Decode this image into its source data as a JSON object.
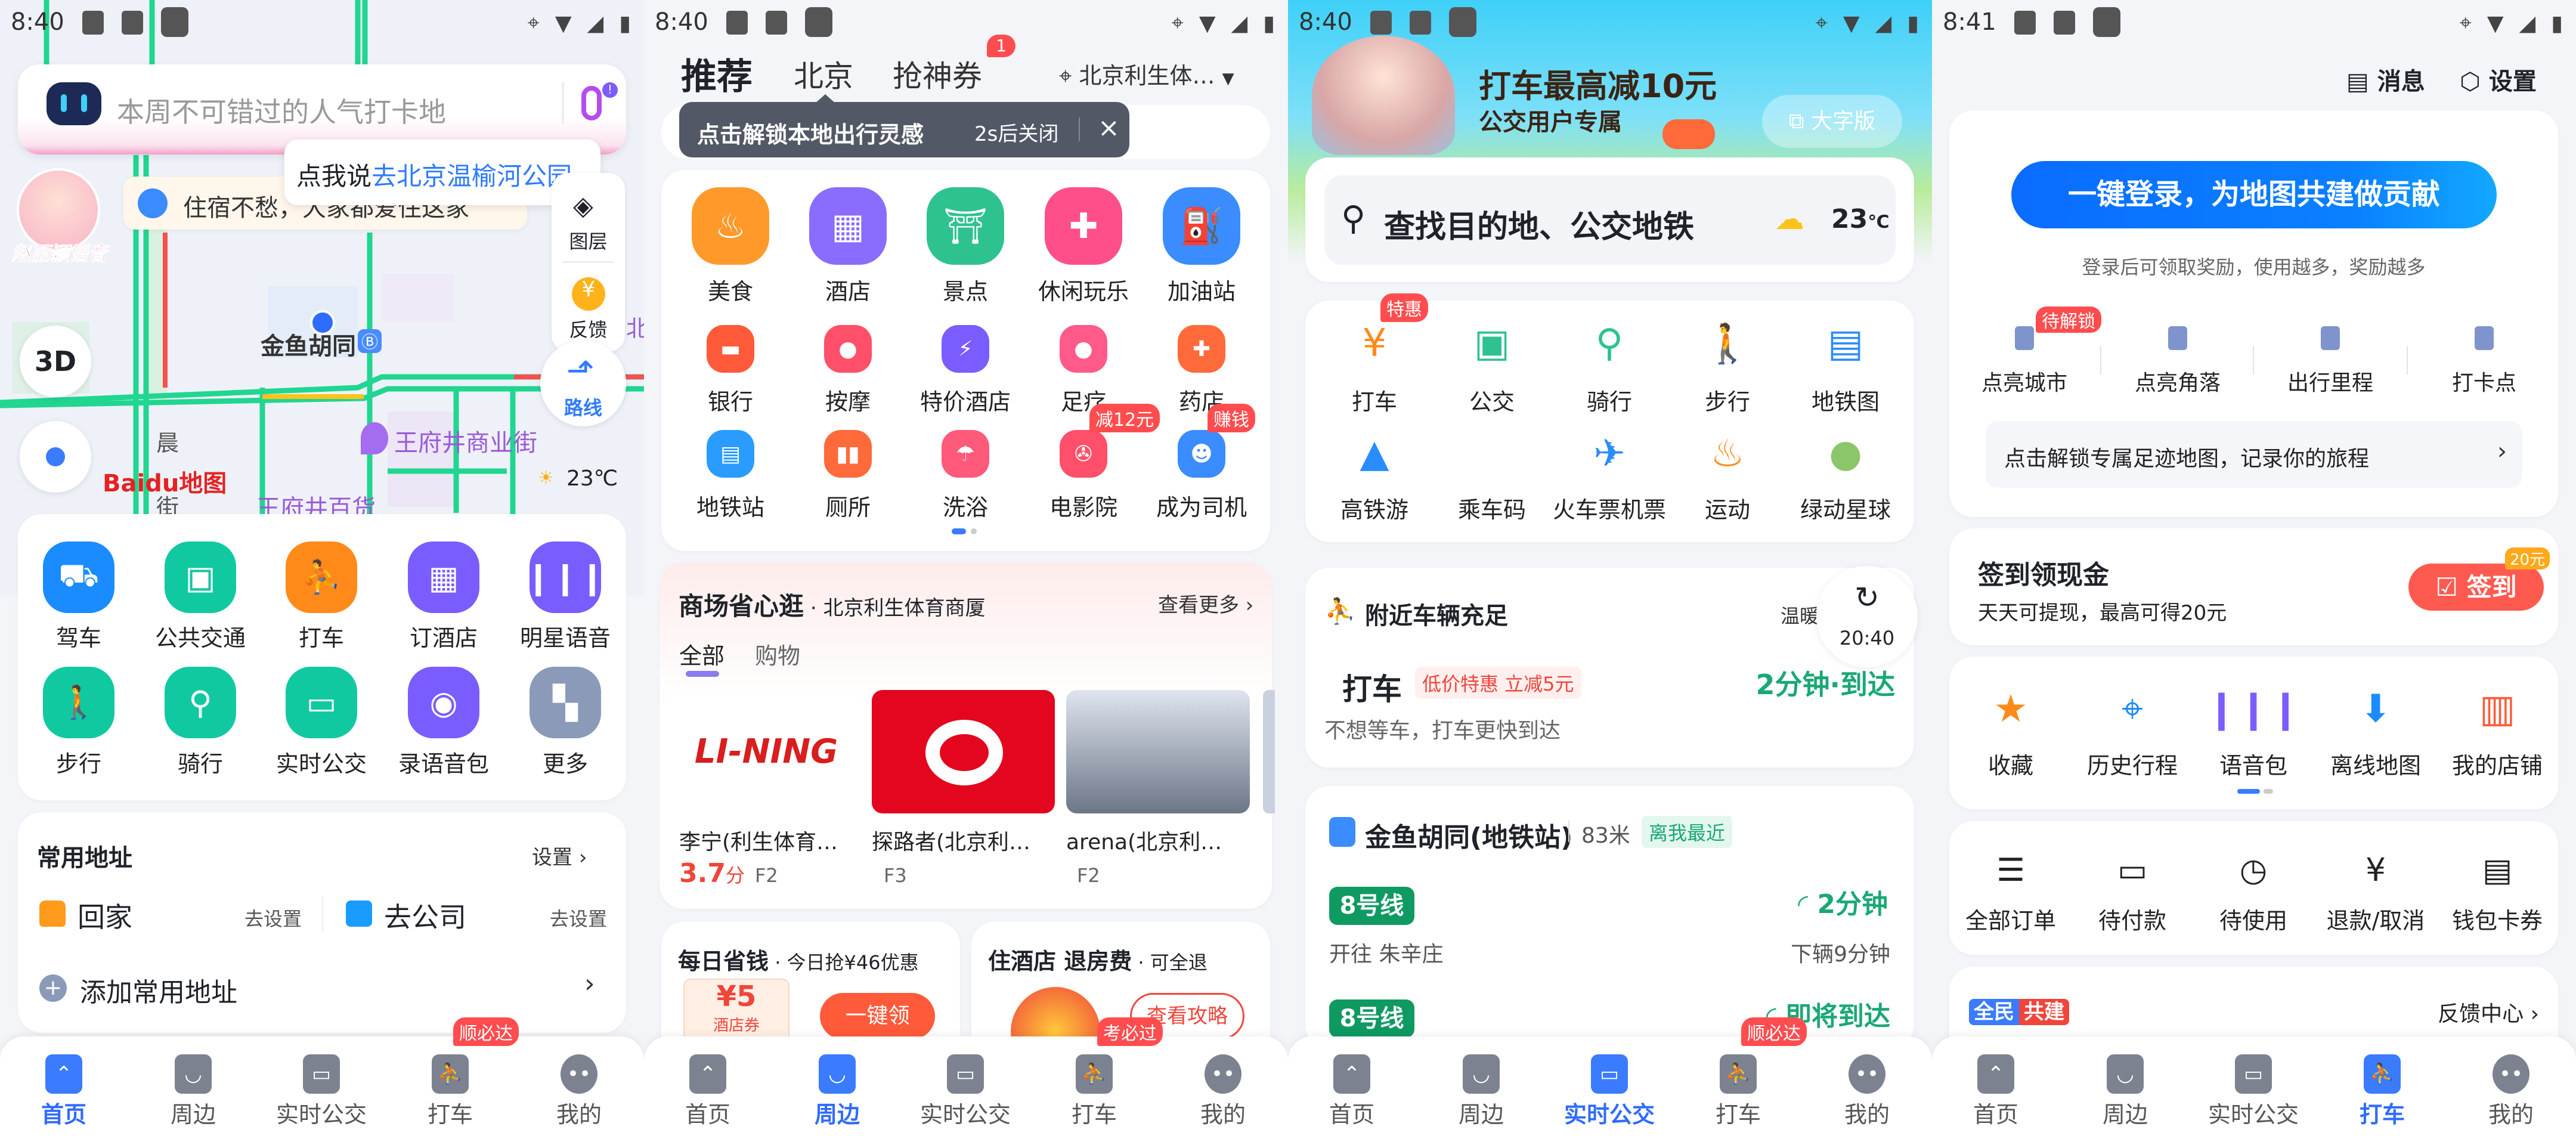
{
  "status_bars": [
    {
      "time": "8:40"
    },
    {
      "time": "8:40"
    },
    {
      "time": "8:40"
    },
    {
      "time": "8:41"
    }
  ],
  "nav": {
    "items": [
      {
        "label": "首页",
        "icon": "home-chevrons-icon"
      },
      {
        "label": "周边",
        "icon": "nearby-bookmark-icon"
      },
      {
        "label": "实时公交",
        "icon": "bus-stop-sign-icon"
      },
      {
        "label": "打车",
        "icon": "taxi-person-icon"
      },
      {
        "label": "我的",
        "icon": "profile-face-icon"
      }
    ],
    "active_color": "#2f6bff"
  },
  "home": {
    "nav_badge": "顺必达",
    "search": {
      "placeholder": "本周不可错过的人气打卡地"
    },
    "voice_tip": {
      "prefix": "点我说",
      "highlight": "去北京温榆河公园"
    },
    "notice": "住宿不愁，大家都爱住这家",
    "avatar_label": "赵丽颖语音",
    "layers": "图层",
    "feedback": "反馈",
    "route": "路线",
    "btn_3d": "3D",
    "weather": "23℃",
    "logo": "Baidu地图",
    "map_labels": {
      "station": "金鱼胡同",
      "street": "王府井商业街",
      "store": "王府井百货",
      "road1": "晨",
      "road2": "街",
      "edge": "北"
    },
    "actions": [
      {
        "label": "驾车",
        "icon": "car-icon",
        "color": "#1a8cff"
      },
      {
        "label": "公共交通",
        "icon": "bus-icon",
        "color": "#11c9a0"
      },
      {
        "label": "打车",
        "icon": "taxi-icon",
        "color": "#ff8a1a"
      },
      {
        "label": "订酒店",
        "icon": "hotel-icon",
        "color": "#7b5cff"
      },
      {
        "label": "明星语音",
        "icon": "voice-wave-icon",
        "color": "#7b5cff"
      },
      {
        "label": "步行",
        "icon": "walk-icon",
        "color": "#11c9a0"
      },
      {
        "label": "骑行",
        "icon": "bike-icon",
        "color": "#11c9a0"
      },
      {
        "label": "实时公交",
        "icon": "bus-stop-icon",
        "color": "#11c9a0"
      },
      {
        "label": "录语音包",
        "icon": "record-icon",
        "color": "#7b5cff"
      },
      {
        "label": "更多",
        "icon": "grid-more-icon",
        "color": "#8a9ab8"
      }
    ],
    "addresses": {
      "title": "常用地址",
      "settings": "设置",
      "home": "回家",
      "home_action": "去设置",
      "work": "去公司",
      "work_action": "去设置",
      "add": "添加常用地址"
    }
  },
  "nearby": {
    "nav_badge": "考必过",
    "tabs": [
      {
        "label": "推荐"
      },
      {
        "label": "北京"
      },
      {
        "label": "抢神券",
        "badge": "1"
      }
    ],
    "location": "北京利生体…",
    "toast": {
      "text": "点击解锁本地出行灵感",
      "timer": "2s后关闭"
    },
    "categories": [
      {
        "label": "美食",
        "icon": "food-icon",
        "color": "#ff9a2a"
      },
      {
        "label": "酒店",
        "icon": "hotel-icon",
        "color": "#8a6cff"
      },
      {
        "label": "景点",
        "icon": "palace-icon",
        "color": "#2ec28f"
      },
      {
        "label": "休闲玩乐",
        "icon": "gamepad-icon",
        "color": "#ff4f8a"
      },
      {
        "label": "加油站",
        "icon": "gas-station-icon",
        "color": "#3a8cff"
      },
      {
        "label": "银行",
        "icon": "bank-card-icon",
        "color": "#ff5a3a"
      },
      {
        "label": "按摩",
        "icon": "massage-icon",
        "color": "#ff4f6a"
      },
      {
        "label": "特价酒店",
        "icon": "discount-hotel-icon",
        "color": "#7b5cff"
      },
      {
        "label": "足疗",
        "icon": "foot-icon",
        "color": "#ff5a8a"
      },
      {
        "label": "药店",
        "icon": "pharmacy-icon",
        "color": "#ff6a3a"
      },
      {
        "label": "地铁站",
        "icon": "subway-icon",
        "color": "#2a9cff"
      },
      {
        "label": "厕所",
        "icon": "toilet-icon",
        "color": "#ff6a3a"
      },
      {
        "label": "洗浴",
        "icon": "shower-icon",
        "color": "#ff5a7a"
      },
      {
        "label": "电影院",
        "icon": "film-reel-icon",
        "color": "#ff4f6a",
        "badge": "减12元"
      },
      {
        "label": "成为司机",
        "icon": "driver-icon",
        "color": "#3a8cff",
        "badge": "赚钱"
      }
    ],
    "mall": {
      "title": "商场省心逛",
      "subtitle": "北京利生体育商厦",
      "more": "查看更多",
      "tabs": [
        "全部",
        "购物"
      ],
      "stores": [
        {
          "name": "李宁(利生体育…",
          "rating": "3.7",
          "rating_unit": "分",
          "floor": "F2",
          "brand": "LI-NING"
        },
        {
          "name": "探路者(北京利…",
          "floor": "F3"
        },
        {
          "name": "arena(北京利…",
          "floor": "F2"
        }
      ]
    },
    "daily": {
      "title": "每日省钱",
      "subtitle": "今日抢¥46优惠",
      "coupon": "¥5",
      "coupon_label": "酒店券",
      "button": "一键领"
    },
    "hotel": {
      "title": "住酒店 退房费",
      "subtitle": "可全退",
      "button": "查看攻略"
    }
  },
  "transit": {
    "nav_badge": "顺必达",
    "banner": {
      "title": "打车最高减10元",
      "subtitle": "公交用户专属",
      "big_font": "大字版"
    },
    "search": {
      "placeholder": "查找目的地、公交地铁",
      "temp": "23",
      "unit": "℃"
    },
    "grid": [
      {
        "label": "打车",
        "icon": "taxi-yuan-icon",
        "color": "#ff8a1a",
        "badge": "特惠"
      },
      {
        "label": "公交",
        "icon": "bus-icon",
        "color": "#2ec28f"
      },
      {
        "label": "骑行",
        "icon": "bike-icon",
        "color": "#2ec28f"
      },
      {
        "label": "步行",
        "icon": "walk-icon",
        "color": "#2ec28f"
      },
      {
        "label": "地铁图",
        "icon": "subway-icon",
        "color": "#2a8cff"
      },
      {
        "label": "高铁游",
        "icon": "picture-icon",
        "color": "#2a8cff"
      },
      {
        "label": "乘车码",
        "icon": "qr-code-icon",
        "color": "#ffffff"
      },
      {
        "label": "火车票机票",
        "icon": "plane-train-icon",
        "color": "#2a8cff"
      },
      {
        "label": "运动",
        "icon": "flame-icon",
        "color": "#ff8a1a"
      },
      {
        "label": "绿动星球",
        "icon": "green-planet-icon",
        "color": "#8cc66a"
      }
    ],
    "taxi": {
      "title": "附近车辆充足",
      "hint": "温暖",
      "refresh_time": "20:40",
      "name": "打车",
      "tag": "低价特惠 立减5元",
      "eta": "2分钟·到达",
      "sub": "不想等车，打车更快到达"
    },
    "station": {
      "name": "金鱼胡同(地铁站)",
      "distance": "83米",
      "tag": "离我最近",
      "lines": [
        {
          "line": "8号线",
          "direction": "开往 朱辛庄",
          "eta": "2分钟",
          "next": "下辆9分钟"
        },
        {
          "line": "8号线",
          "eta": "即将到达"
        }
      ]
    }
  },
  "mine": {
    "messages": "消息",
    "settings": "设置",
    "login": "一键登录，为地图共建做贡献",
    "login_hint": "登录后可领取奖励，使用越多，奖励越多",
    "unlock_badge": "待解锁",
    "footprints": [
      {
        "label": "点亮城市"
      },
      {
        "label": "点亮角落"
      },
      {
        "label": "出行里程"
      },
      {
        "label": "打卡点"
      }
    ],
    "footprint_bar": "点击解锁专属足迹地图，记录你的旅程",
    "sign": {
      "title": "签到领现金",
      "sub": "天天可提现，最高可得20元",
      "button": "签到",
      "badge": "20元"
    },
    "tools": [
      {
        "label": "收藏",
        "icon": "star-icon",
        "color": "#ff8a1a"
      },
      {
        "label": "历史行程",
        "icon": "history-trip-icon",
        "color": "#1a8cff"
      },
      {
        "label": "语音包",
        "icon": "voice-wave-icon",
        "color": "#7b5cff"
      },
      {
        "label": "离线地图",
        "icon": "cloud-download-icon",
        "color": "#1a8cff"
      },
      {
        "label": "我的店铺",
        "icon": "shop-icon",
        "color": "#ff5a3a"
      }
    ],
    "orders": [
      {
        "label": "全部订单",
        "icon": "order-list-icon"
      },
      {
        "label": "待付款",
        "icon": "card-pay-icon"
      },
      {
        "label": "待使用",
        "icon": "clock-icon"
      },
      {
        "label": "退款/取消",
        "icon": "refund-yuan-icon"
      },
      {
        "label": "钱包卡券",
        "icon": "wallet-icon"
      }
    ],
    "cobuild": {
      "left": "全民",
      "right": "共建",
      "link": "反馈中心"
    }
  }
}
